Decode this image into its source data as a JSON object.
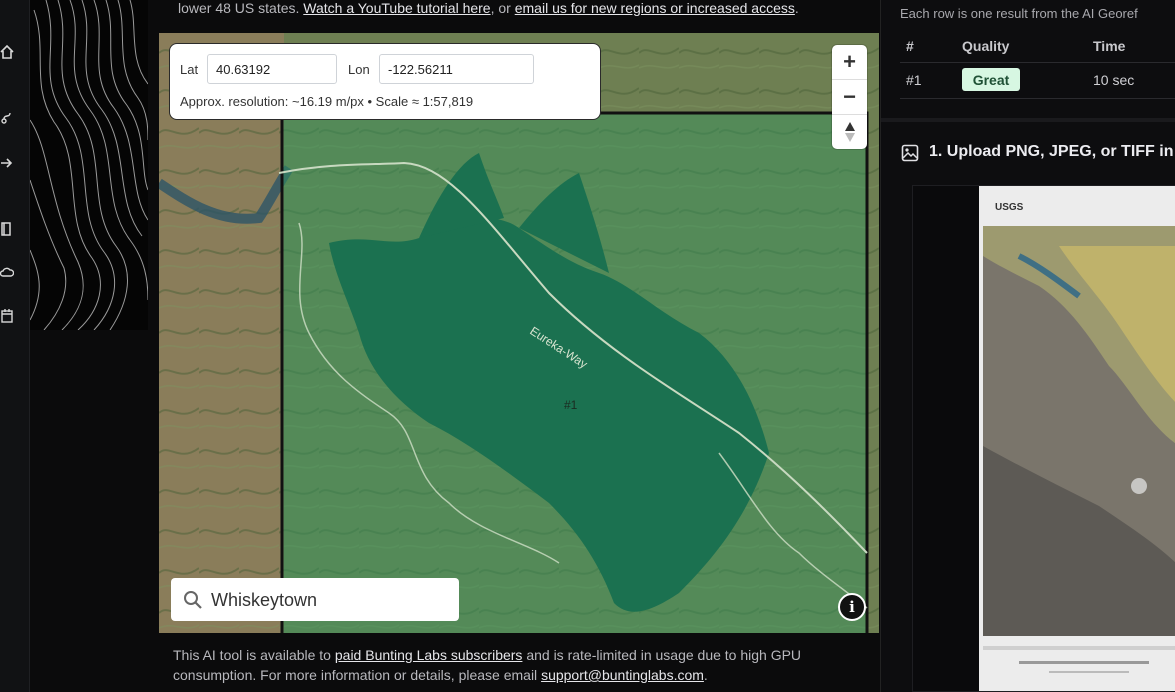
{
  "top_caption": {
    "prefix": "lower 48 US states. ",
    "link1": "Watch a YouTube tutorial here",
    "middle": ", or ",
    "link2": "email us for new regions or increased access",
    "suffix": "."
  },
  "coordinates": {
    "lat_label": "Lat",
    "lat_value": "40.63192",
    "lon_label": "Lon",
    "lon_value": "-122.56211",
    "resolution_text": "Approx. resolution: ~16.19 m/px • Scale ≈ 1:57,819"
  },
  "map": {
    "road_label": "Eureka-Way",
    "result_label": "#1",
    "zoom_in": "+",
    "zoom_out": "−",
    "info_symbol": "i"
  },
  "search": {
    "value": "Whiskeytown"
  },
  "bottom_caption": {
    "line1_prefix": "This AI tool is available to ",
    "link1": "paid Bunting Labs subscribers",
    "line1_suffix": " and is rate-limited in usage due to high GPU consumption. For more information or details, please email ",
    "email": "support@buntinglabs.com",
    "suffix": "."
  },
  "results": {
    "caption": "Each row is one result from the AI Georef",
    "columns": [
      "#",
      "Quality",
      "Time"
    ],
    "rows": [
      {
        "num": "#1",
        "quality": "Great",
        "time": "10 sec"
      }
    ]
  },
  "upload": {
    "heading": "1. Upload PNG, JPEG, or TIFF in",
    "preview_logo": "USGS"
  },
  "colors": {
    "map_overlay": "#1f8a5b",
    "badge_bg": "#d7f7e2",
    "badge_text": "#1f5135"
  },
  "icons": [
    "home-icon",
    "route-icon",
    "arrow-right-icon",
    "book-icon",
    "cloud-icon",
    "calendar-icon",
    "search-icon",
    "image-icon",
    "compass-icon",
    "info-icon"
  ]
}
